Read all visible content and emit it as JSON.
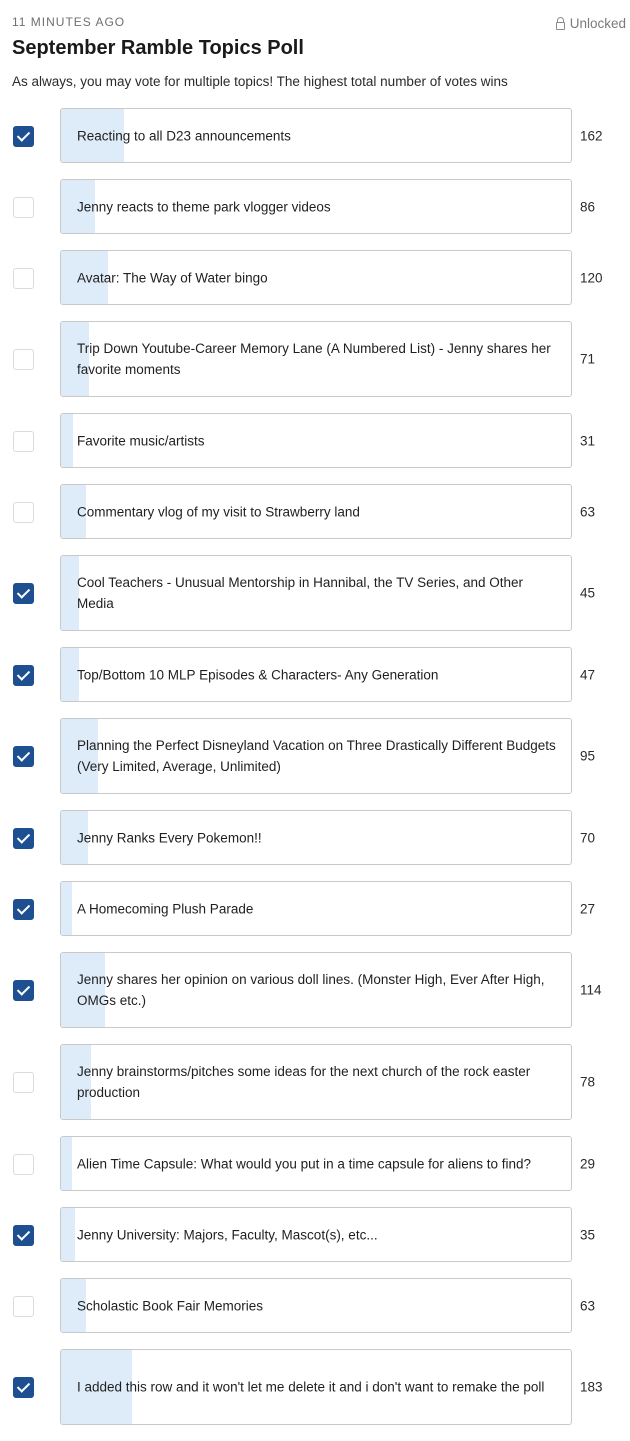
{
  "poll": {
    "time_ago": "11 MINUTES AGO",
    "lock_status": "Unlocked",
    "title": "September Ramble Topics Poll",
    "description": "As always, you may vote for multiple topics! The highest total number of votes wins",
    "max_votes": 183,
    "options": [
      {
        "label": "Reacting to all D23 announcements",
        "votes": 162,
        "checked": true,
        "tall": false
      },
      {
        "label": "Jenny reacts to theme park vlogger videos",
        "votes": 86,
        "checked": false,
        "tall": false
      },
      {
        "label": "Avatar: The Way of Water bingo",
        "votes": 120,
        "checked": false,
        "tall": false
      },
      {
        "label": "Trip Down Youtube-Career Memory Lane (A Numbered List) - Jenny shares her favorite moments",
        "votes": 71,
        "checked": false,
        "tall": true
      },
      {
        "label": "Favorite music/artists",
        "votes": 31,
        "checked": false,
        "tall": false
      },
      {
        "label": "Commentary vlog of my visit to Strawberry land",
        "votes": 63,
        "checked": false,
        "tall": false
      },
      {
        "label": "Cool Teachers - Unusual Mentorship in Hannibal, the TV Series, and Other Media",
        "votes": 45,
        "checked": true,
        "tall": true
      },
      {
        "label": "Top/Bottom 10 MLP Episodes & Characters- Any Generation",
        "votes": 47,
        "checked": true,
        "tall": false
      },
      {
        "label": "Planning the Perfect Disneyland Vacation on Three Drastically Different Budgets (Very Limited, Average, Unlimited)",
        "votes": 95,
        "checked": true,
        "tall": true
      },
      {
        "label": "Jenny Ranks Every Pokemon!!",
        "votes": 70,
        "checked": true,
        "tall": false
      },
      {
        "label": "A Homecoming Plush Parade",
        "votes": 27,
        "checked": true,
        "tall": false
      },
      {
        "label": "Jenny shares her opinion on various doll lines. (Monster High, Ever After High, OMGs etc.)",
        "votes": 114,
        "checked": true,
        "tall": true
      },
      {
        "label": "Jenny brainstorms/pitches some ideas for the next church of the rock easter production",
        "votes": 78,
        "checked": false,
        "tall": true
      },
      {
        "label": "Alien Time Capsule: What would you put in a time capsule for aliens to find?",
        "votes": 29,
        "checked": false,
        "tall": false
      },
      {
        "label": "Jenny University: Majors, Faculty, Mascot(s), etc...",
        "votes": 35,
        "checked": true,
        "tall": false
      },
      {
        "label": "Scholastic Book Fair Memories",
        "votes": 63,
        "checked": false,
        "tall": false
      },
      {
        "label": "I added this row and it won't let me delete it and i don't want to remake the poll",
        "votes": 183,
        "checked": true,
        "tall": true
      }
    ]
  }
}
